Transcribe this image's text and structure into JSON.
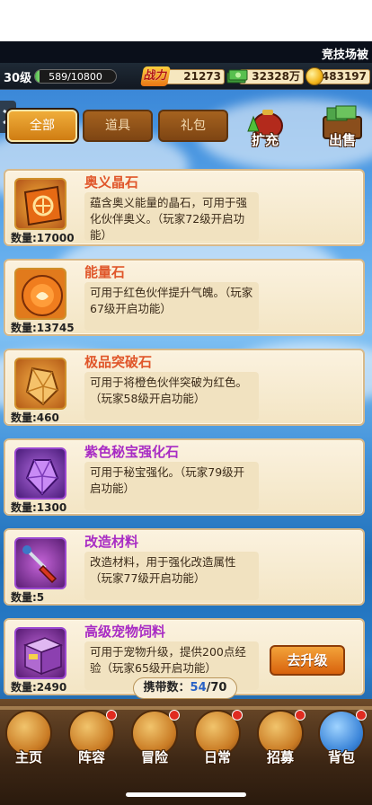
{
  "top": {
    "arena_label": "竞技场被"
  },
  "resources": {
    "level": "30级",
    "exp": "589/10800",
    "exp_progress": 0.055,
    "power_label": "战力",
    "power": "21273",
    "money": "32328万",
    "gold": "483197"
  },
  "tabs": [
    {
      "label": "全部",
      "active": true
    },
    {
      "label": "道具",
      "active": false
    },
    {
      "label": "礼包",
      "active": false
    }
  ],
  "actions": {
    "expand": "扩充",
    "sell": "出售"
  },
  "items": [
    {
      "name": "奥义晶石",
      "name_color": "#e0562a",
      "qty": "数量:17000",
      "desc": "蕴含奥义能量的晶石，可用于强化伙伴奥义。（玩家72级开启功能）",
      "icon": "crystal-icon"
    },
    {
      "name": "能量石",
      "name_color": "#e0562a",
      "qty": "数量:13745",
      "desc": "可用于红色伙伴提升气魄。（玩家67级开启功能）",
      "icon": "energy-stone-icon"
    },
    {
      "name": "极品突破石",
      "name_color": "#e0562a",
      "qty": "数量:460",
      "desc": "可用于将橙色伙伴突破为红色。（玩家58级开启功能）",
      "icon": "breakthrough-stone-icon"
    },
    {
      "name": "紫色秘宝强化石",
      "name_color": "#a82bc4",
      "qty": "数量:1300",
      "desc": "可用于秘宝强化。（玩家79级开启功能）",
      "icon": "purple-gem-icon"
    },
    {
      "name": "改造材料",
      "name_color": "#a82bc4",
      "qty": "数量:5",
      "desc": "改造材料，用于强化改造属性（玩家77级开启功能）",
      "icon": "screwdriver-icon"
    },
    {
      "name": "高级宠物饲料",
      "name_color": "#a82bc4",
      "qty": "数量:2490",
      "desc": "可用于宠物升级，提供200点经验（玩家65级开启功能）",
      "icon": "pet-food-box-icon",
      "button": "去升级"
    }
  ],
  "carry": {
    "label": "携带数：",
    "current": "54",
    "total": "/70"
  },
  "nav": [
    {
      "label": "主页",
      "icon": "home-icon",
      "dot": false
    },
    {
      "label": "阵容",
      "icon": "lineup-icon",
      "dot": true
    },
    {
      "label": "冒险",
      "icon": "adventure-skull-icon",
      "dot": true
    },
    {
      "label": "日常",
      "icon": "daily-swords-icon",
      "dot": true
    },
    {
      "label": "招募",
      "icon": "recruit-tavern-icon",
      "dot": true
    },
    {
      "label": "背包",
      "icon": "bag-icon",
      "dot": true
    }
  ],
  "colors": {
    "accent": "#d8620d",
    "carry_current": "#2962c6"
  }
}
